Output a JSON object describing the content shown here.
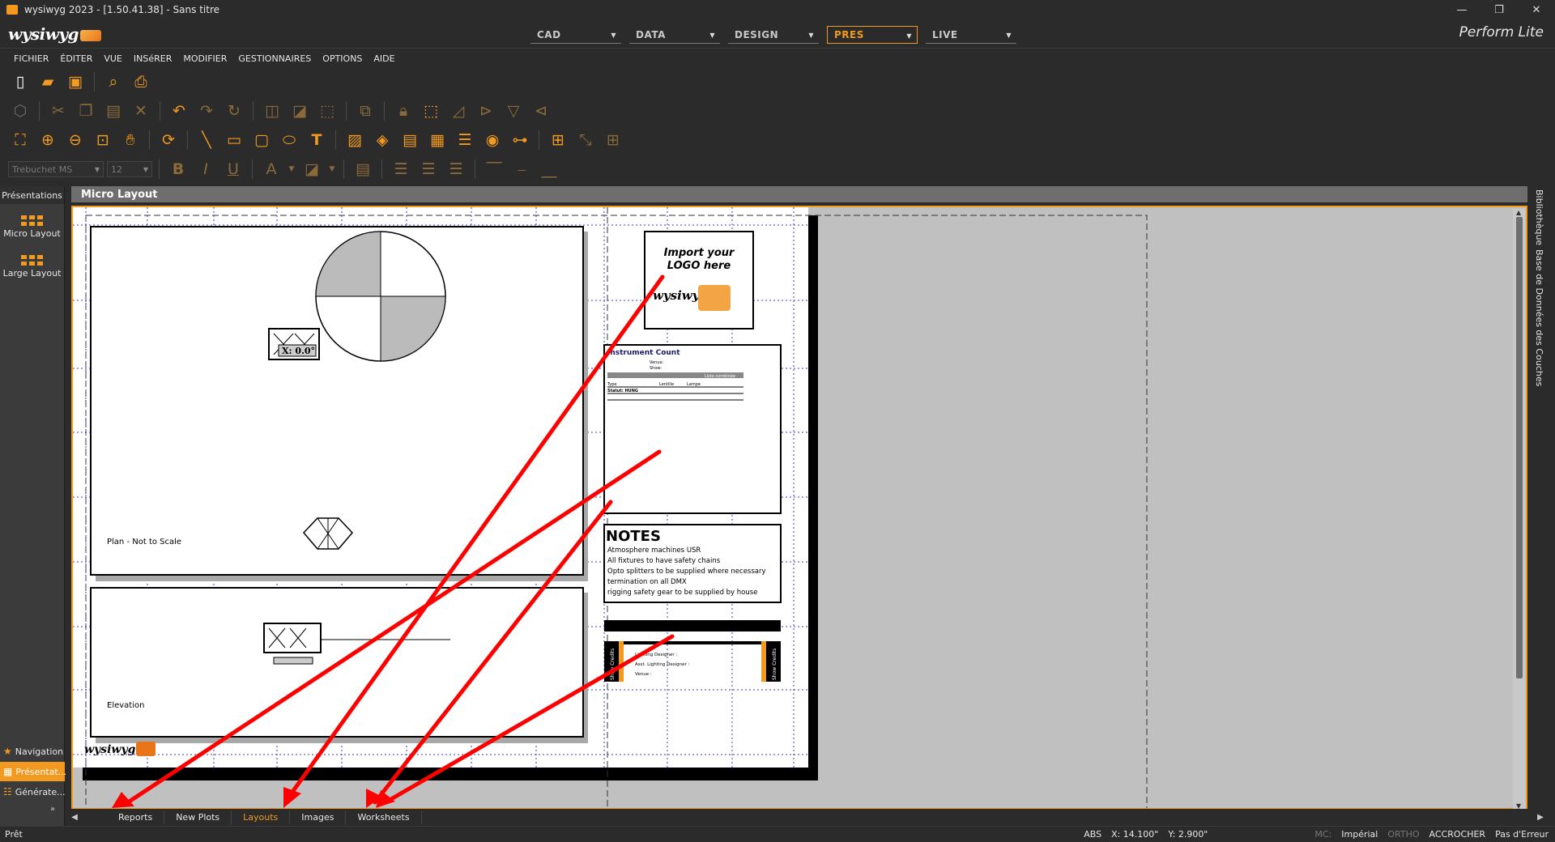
{
  "window": {
    "title": "wysiwyg 2023 - [1.50.41.38] - Sans titre",
    "minimize": "—",
    "restore": "❐",
    "close": "✕"
  },
  "brand": {
    "logo": "wysiwyg",
    "product": "Perform Lite"
  },
  "modes": [
    {
      "label": "CAD",
      "active": false
    },
    {
      "label": "DATA",
      "active": false
    },
    {
      "label": "DESIGN",
      "active": false
    },
    {
      "label": "PRES",
      "active": true
    },
    {
      "label": "LIVE",
      "active": false
    }
  ],
  "menu": [
    "FICHIER",
    "ÉDITER",
    "VUE",
    "INSéRER",
    "MODIFIER",
    "GESTIONNAIRES",
    "OPTIONS",
    "AIDE"
  ],
  "format": {
    "font": "Trebuchet MS",
    "size": "12"
  },
  "left_panel": {
    "title": "Présentations",
    "items": [
      {
        "label": "Micro Layout",
        "icon": "layout-grid-icon"
      },
      {
        "label": "Large Layout",
        "icon": "layout-grid-icon"
      }
    ],
    "bottom": [
      {
        "label": "Navigation",
        "icon": "star-icon",
        "active": false
      },
      {
        "label": "Présentat...",
        "icon": "presentation-icon",
        "active": true
      },
      {
        "label": "Générate...",
        "icon": "generator-icon",
        "active": false
      }
    ]
  },
  "document": {
    "title": "Micro Layout",
    "plan_label": "Plan - Not to Scale",
    "elevation_label": "Elevation",
    "logo_box": {
      "line1": "Import your",
      "line2": "LOGO here",
      "brand": "wysiwyg"
    },
    "instrument_count": {
      "title": "Instrument Count",
      "venue": "Venue:",
      "show": "Show:",
      "header_right": "Liste combinée",
      "col1": "Type",
      "col2": "Lentille",
      "col3": "Lampe",
      "group": "Statut: HUNG"
    },
    "notes": {
      "title": "NOTES",
      "lines": [
        "Atmosphere machines USR",
        "All fixtures to have safety chains",
        "Opto splitters to be supplied where necessary",
        "termination on all DMX",
        "rigging safety gear to be supplied by house"
      ]
    },
    "credits": {
      "side_label": "Show Credits",
      "lines": [
        "Lighting Designer :",
        "Asst. Lighting Designer :",
        "Venue :"
      ]
    },
    "scale_label": "X: 0.0°",
    "footer_logo": "wysiwyg"
  },
  "right_dock": {
    "tabs": [
      "Bibliothèque",
      "Base de Données des Couches"
    ]
  },
  "sheet_tabs": [
    {
      "label": "Reports",
      "active": false
    },
    {
      "label": "New Plots",
      "active": false
    },
    {
      "label": "Layouts",
      "active": true
    },
    {
      "label": "Images",
      "active": false
    },
    {
      "label": "Worksheets",
      "active": false
    }
  ],
  "status": {
    "ready": "Prêt",
    "abs": "ABS",
    "x": "X: 14.100\"",
    "y": "Y: 2.900\"",
    "mc": "MC:",
    "units": "Impérial",
    "ortho": "ORTHO",
    "snap": "ACCROCHER",
    "errors": "Pas d'Erreur"
  },
  "colors": {
    "accent": "#f29a1f",
    "arrow": "#ff0000",
    "canvas_bg": "#c0c0c0",
    "chrome": "#2b2b2b"
  }
}
